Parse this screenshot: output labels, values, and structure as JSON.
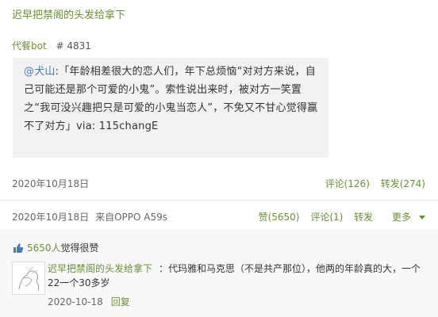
{
  "title": "迟早把禁阁的头发给拿下",
  "source": {
    "name": "代餐bot",
    "post_number": "# 4831"
  },
  "quote": {
    "mention": "@犬山",
    "text": ":「年龄相差很大的恋人们，年下总烦恼“对对方来说，自己可能还是那个可爱的小鬼”。索性说出来时，被对方一笑置之“我可没兴趣把只是可爱的小鬼当恋人”，不免又不甘心觉得赢不了对方」via: 115changE"
  },
  "original_meta": {
    "date": "2020年10月18日",
    "comments": "评论(126)",
    "reposts": "转发(274)"
  },
  "repost_meta": {
    "date": "2020年10月18日",
    "device": "来自OPPO A59s",
    "likes": "赞(5650)",
    "comments": "评论(1)",
    "repost": "转发",
    "more": "更多"
  },
  "like_summary": {
    "count": "5650人",
    "text": "觉得很赞"
  },
  "comment": {
    "author": "迟早把禁阁的头发给拿下",
    "text": "：代玛雅和马克思（不是共产那位），他两的年龄真的大，一个22一个30多岁",
    "date": "2020-10-18",
    "reply": "回复"
  }
}
